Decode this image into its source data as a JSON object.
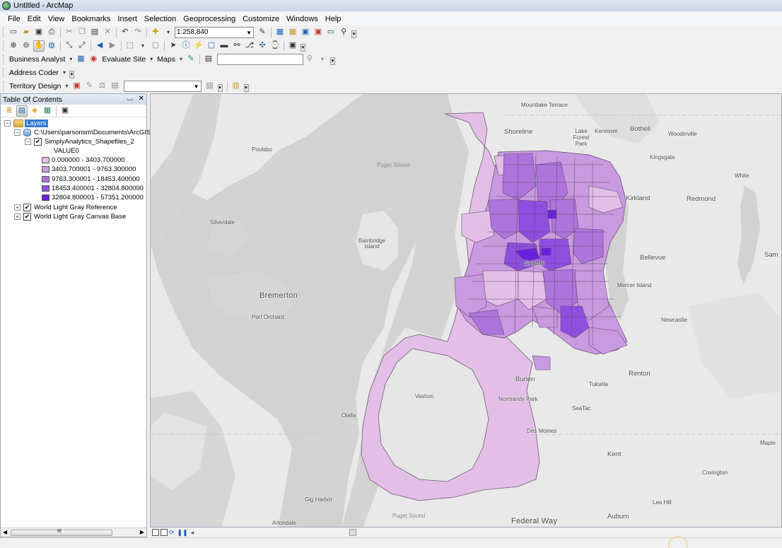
{
  "window": {
    "title": "Untitled - ArcMap"
  },
  "menu": [
    "File",
    "Edit",
    "View",
    "Bookmarks",
    "Insert",
    "Selection",
    "Geoprocessing",
    "Customize",
    "Windows",
    "Help"
  ],
  "toolbar": {
    "scale_value": "1:258,840",
    "business_analyst_label": "Business Analyst",
    "evaluate_site_label": "Evaluate Site",
    "maps_label": "Maps",
    "address_coder_label": "Address Coder",
    "territory_design_label": "Territory Design",
    "search_value": "",
    "territory_dropdown_value": ""
  },
  "toc": {
    "title": "Table Of Contents",
    "pin_glyph": "⌴",
    "close_glyph": "✕",
    "root_label": "Layers",
    "path_label": "C:\\Users\\parsonsm\\Documents\\ArcGIS\\",
    "layer_label": "SimplyAnalytics_Shapefiles_2",
    "field_label": "VALUE0",
    "legend": [
      {
        "label": "0.000000 - 3403.700000",
        "color": "#e3bfe8"
      },
      {
        "label": "3403.700001 - 9763.300000",
        "color": "#c99ae0"
      },
      {
        "label": "9763.300001 - 18453.400000",
        "color": "#ad74db"
      },
      {
        "label": "18453.400001 - 32804.800000",
        "color": "#8e4ee0"
      },
      {
        "label": "32804.800001 - 57351.200000",
        "color": "#6a1fe0"
      }
    ],
    "other_layers": [
      "World Light Gray Reference",
      "World Light Gray Canvas Base"
    ],
    "scroll_glyph": "III"
  },
  "map": {
    "places": [
      {
        "name": "Mountlake Terrace",
        "size": "sm"
      },
      {
        "name": "Shoreline",
        "size": "med"
      },
      {
        "name": "Lake Forest Park",
        "size": "sm"
      },
      {
        "name": "Kenmore",
        "size": "sm"
      },
      {
        "name": "Bothell",
        "size": "med"
      },
      {
        "name": "Woodinville",
        "size": "sm"
      },
      {
        "name": "Kingsgate",
        "size": "sm"
      },
      {
        "name": "White",
        "size": "sm"
      },
      {
        "name": "Poulsbo",
        "size": "sm"
      },
      {
        "name": "Puget Sound",
        "size": "med"
      },
      {
        "name": "Kirkland",
        "size": "med"
      },
      {
        "name": "Redmond",
        "size": "med"
      },
      {
        "name": "Silverdale",
        "size": "sm"
      },
      {
        "name": "Bainbridge Island",
        "size": "sm"
      },
      {
        "name": "Seattle",
        "size": "med"
      },
      {
        "name": "Bellevue",
        "size": "med"
      },
      {
        "name": "Sam",
        "size": "med"
      },
      {
        "name": "Bremerton",
        "size": "big"
      },
      {
        "name": "Mercer Island",
        "size": "sm"
      },
      {
        "name": "Port Orchard",
        "size": "sm"
      },
      {
        "name": "Newcastle",
        "size": "sm"
      },
      {
        "name": "Renton",
        "size": "med"
      },
      {
        "name": "Burien",
        "size": "med"
      },
      {
        "name": "Tukwila",
        "size": "sm"
      },
      {
        "name": "Vashon",
        "size": "sm"
      },
      {
        "name": "Normandy Park",
        "size": "sm"
      },
      {
        "name": "SeaTac",
        "size": "sm"
      },
      {
        "name": "Olalla",
        "size": "sm"
      },
      {
        "name": "Des Moines",
        "size": "sm"
      },
      {
        "name": "Maple",
        "size": "sm"
      },
      {
        "name": "Kent",
        "size": "med"
      },
      {
        "name": "Covington",
        "size": "sm"
      },
      {
        "name": "Gig Harbor",
        "size": "sm"
      },
      {
        "name": "Lea Hill",
        "size": "sm"
      },
      {
        "name": "Puget Sound",
        "size": "sm"
      },
      {
        "name": "Arlondale",
        "size": "sm"
      },
      {
        "name": "Federal Way",
        "size": "big"
      },
      {
        "name": "Auburn",
        "size": "med"
      }
    ]
  },
  "colors": {
    "water": "#d3d3d3",
    "land": "#eaeaea",
    "accent": "#3379d6"
  }
}
